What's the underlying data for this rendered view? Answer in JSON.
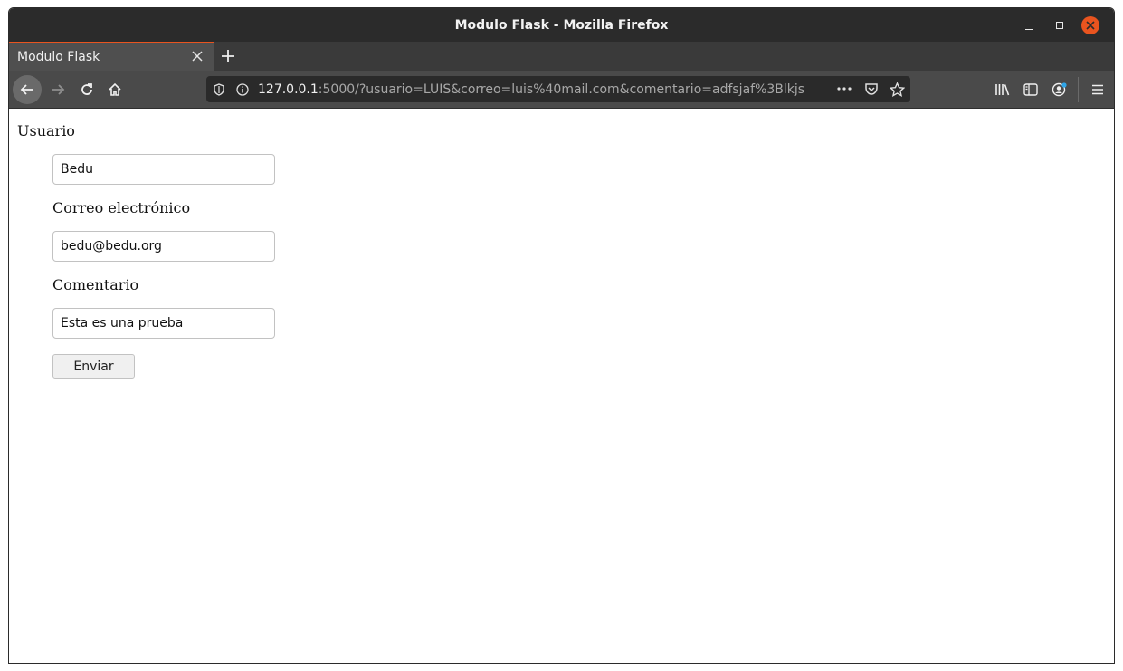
{
  "window": {
    "title": "Modulo Flask - Mozilla Firefox"
  },
  "tabs": [
    {
      "label": "Modulo Flask",
      "active": true
    }
  ],
  "urlbar": {
    "host": "127.0.0.1",
    "rest": ":5000/?usuario=LUIS&correo=luis%40mail.com&comentario=adfsjaf%3Blkjs"
  },
  "form": {
    "usuario_label": "Usuario",
    "usuario_value": "Bedu",
    "correo_label": "Correo electrónico",
    "correo_value": "bedu@bedu.org",
    "comentario_label": "Comentario",
    "comentario_value": "Esta es una prueba",
    "submit_label": "Enviar"
  },
  "colors": {
    "accent": "#e9541f",
    "titlebar": "#2b2b2b",
    "toolbar": "#4a4a4a",
    "url_bg": "#2a2a2a",
    "notification_dot": "#2fa5e8"
  },
  "icons": {
    "back": "arrow-left-icon",
    "forward": "arrow-right-icon",
    "reload": "reload-icon",
    "home": "home-icon",
    "shield": "shield-icon",
    "info": "info-icon",
    "page_actions": "more-horizontal-icon",
    "pocket": "pocket-icon",
    "bookmark": "star-icon",
    "library": "library-icon",
    "sidebar": "sidebar-icon",
    "account": "account-icon",
    "menu": "hamburger-menu-icon"
  }
}
